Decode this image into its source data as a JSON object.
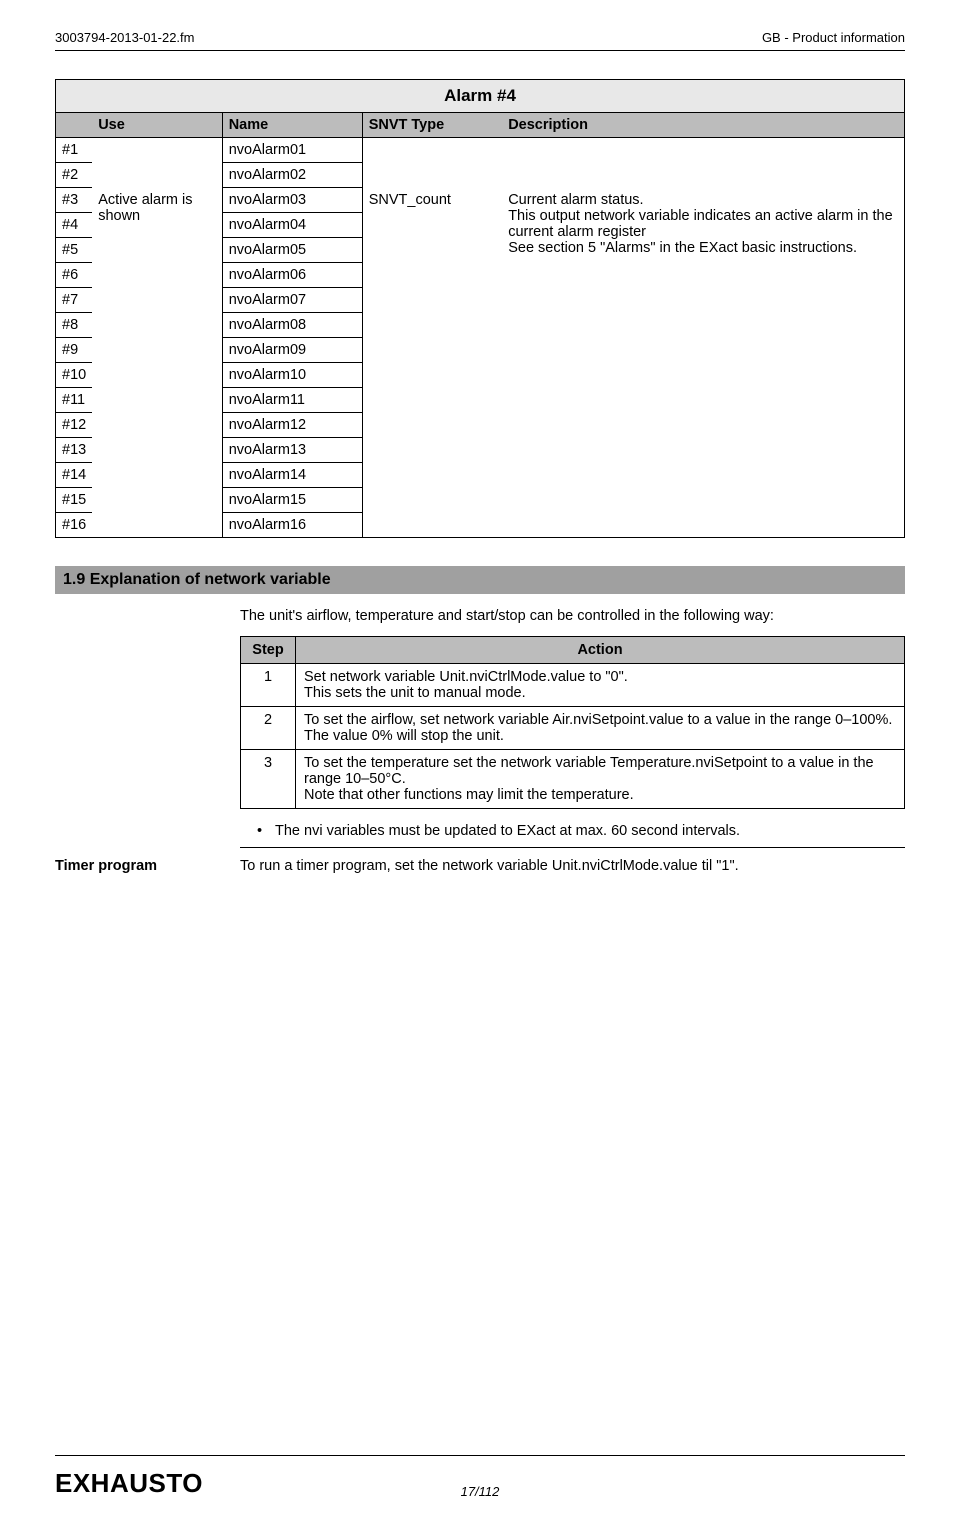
{
  "header": {
    "left": "3003794-2013-01-22.fm",
    "right": "GB - Product information"
  },
  "alarm_table": {
    "title": "Alarm #4",
    "headers": {
      "use": "Use",
      "name": "Name",
      "snvt": "SNVT Type",
      "desc": "Description"
    },
    "use_text": "Active alarm is shown",
    "snvt_text": "SNVT_count",
    "desc_text": "Current alarm status.\nThis output network variable indicates an active alarm in the current alarm register\nSee section 5 \"Alarms\" in the EXact basic instructions.",
    "rows": [
      {
        "n": "#1",
        "name": "nvoAlarm01"
      },
      {
        "n": "#2",
        "name": "nvoAlarm02"
      },
      {
        "n": "#3",
        "name": "nvoAlarm03"
      },
      {
        "n": "#4",
        "name": "nvoAlarm04"
      },
      {
        "n": "#5",
        "name": "nvoAlarm05"
      },
      {
        "n": "#6",
        "name": "nvoAlarm06"
      },
      {
        "n": "#7",
        "name": "nvoAlarm07"
      },
      {
        "n": "#8",
        "name": "nvoAlarm08"
      },
      {
        "n": "#9",
        "name": "nvoAlarm09"
      },
      {
        "n": "#10",
        "name": "nvoAlarm10"
      },
      {
        "n": "#11",
        "name": "nvoAlarm11"
      },
      {
        "n": "#12",
        "name": "nvoAlarm12"
      },
      {
        "n": "#13",
        "name": "nvoAlarm13"
      },
      {
        "n": "#14",
        "name": "nvoAlarm14"
      },
      {
        "n": "#15",
        "name": "nvoAlarm15"
      },
      {
        "n": "#16",
        "name": "nvoAlarm16"
      }
    ]
  },
  "section": {
    "heading": "1.9   Explanation of network variable",
    "intro": "The unit's airflow, temperature and start/stop can be controlled in the following way:",
    "step_header": "Step",
    "action_header": "Action",
    "steps": [
      {
        "n": "1",
        "action": "Set network variable Unit.nviCtrlMode.value to \"0\".\nThis sets the unit to manual mode."
      },
      {
        "n": "2",
        "action": "To set the airflow, set network variable Air.nviSetpoint.value to a value in the range 0–100%.\nThe value 0% will stop the unit."
      },
      {
        "n": "3",
        "action": "To set the temperature  set the network variable Temperature.nviSetpoint to a value in the range 10–50°C.\nNote that other functions may limit the temperature."
      }
    ],
    "bullet": "The nvi variables must be updated to EXact at max. 60 second intervals.",
    "timer_label": "Timer program",
    "timer_text": "To run a timer program, set the network variable Unit.nviCtrlMode.value til \"1\"."
  },
  "footer": {
    "page": "17/112",
    "brand": "EXHAUSTO"
  }
}
